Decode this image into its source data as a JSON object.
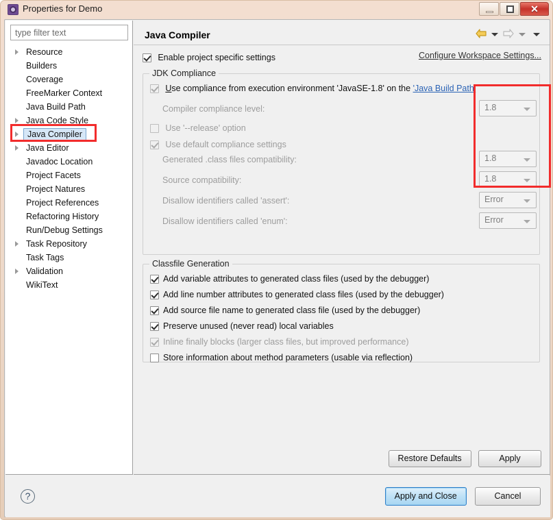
{
  "window": {
    "title": "Properties for Demo",
    "icon": "gear-icon",
    "minimize_label": "Minimize",
    "maximize_label": "Maximize",
    "close_label": "✕"
  },
  "sidebar": {
    "filter": {
      "placeholder": "type filter text",
      "value": ""
    },
    "items": [
      {
        "label": "Resource",
        "expandable": true,
        "selected": false
      },
      {
        "label": "Builders",
        "expandable": false,
        "selected": false
      },
      {
        "label": "Coverage",
        "expandable": false,
        "selected": false
      },
      {
        "label": "FreeMarker Context",
        "expandable": false,
        "selected": false
      },
      {
        "label": "Java Build Path",
        "expandable": false,
        "selected": false
      },
      {
        "label": "Java Code Style",
        "expandable": true,
        "selected": false
      },
      {
        "label": "Java Compiler",
        "expandable": true,
        "selected": true
      },
      {
        "label": "Java Editor",
        "expandable": true,
        "selected": false
      },
      {
        "label": "Javadoc Location",
        "expandable": false,
        "selected": false
      },
      {
        "label": "Project Facets",
        "expandable": false,
        "selected": false
      },
      {
        "label": "Project Natures",
        "expandable": false,
        "selected": false
      },
      {
        "label": "Project References",
        "expandable": false,
        "selected": false
      },
      {
        "label": "Refactoring History",
        "expandable": false,
        "selected": false
      },
      {
        "label": "Run/Debug Settings",
        "expandable": false,
        "selected": false
      },
      {
        "label": "Task Repository",
        "expandable": true,
        "selected": false
      },
      {
        "label": "Task Tags",
        "expandable": false,
        "selected": false
      },
      {
        "label": "Validation",
        "expandable": true,
        "selected": false
      },
      {
        "label": "WikiText",
        "expandable": false,
        "selected": false
      }
    ]
  },
  "page": {
    "title": "Java Compiler",
    "nav": {
      "back_icon": "back-arrow-icon",
      "back_menu_icon": "chevron-down-icon",
      "forward_icon": "forward-arrow-icon",
      "forward_menu_icon": "chevron-down-icon",
      "view_menu_icon": "chevron-down-icon"
    },
    "enable_project_specific": {
      "label": "Enable project specific settings",
      "checked": true
    },
    "configure_workspace_link": "Configure Workspace Settings...",
    "jdk_compliance": {
      "legend": "JDK Compliance",
      "use_execution_env": {
        "label_pre": "Use compliance from execution environment 'JavaSE-1.8' on the ",
        "label_link": "'Java Build Path'",
        "checked": true,
        "mnemonic": "U"
      },
      "compiler_compliance_level": {
        "label": "Compiler compliance level:",
        "value": "1.8",
        "enabled": false
      },
      "use_release_option": {
        "label": "Use '--release' option",
        "checked": false,
        "enabled": false
      },
      "use_default_compliance": {
        "label": "Use default compliance settings",
        "checked": true,
        "enabled": false
      },
      "generated_class_compat": {
        "label": "Generated .class files compatibility:",
        "value": "1.8",
        "enabled": false
      },
      "source_compat": {
        "label": "Source compatibility:",
        "value": "1.8",
        "enabled": false
      },
      "disallow_assert": {
        "label": "Disallow identifiers called 'assert':",
        "value": "Error",
        "enabled": false
      },
      "disallow_enum": {
        "label": "Disallow identifiers called 'enum':",
        "value": "Error",
        "enabled": false
      }
    },
    "classfile_generation": {
      "legend": "Classfile Generation",
      "options": [
        {
          "label": "Add variable attributes to generated class files (used by the debugger)",
          "checked": true,
          "enabled": true
        },
        {
          "label": "Add line number attributes to generated class files (used by the debugger)",
          "checked": true,
          "enabled": true
        },
        {
          "label": "Add source file name to generated class file (used by the debugger)",
          "checked": true,
          "enabled": true
        },
        {
          "label": "Preserve unused (never read) local variables",
          "checked": true,
          "enabled": true
        },
        {
          "label": "Inline finally blocks (larger class files, but improved performance)",
          "checked": true,
          "enabled": false
        },
        {
          "label": "Store information about method parameters (usable via reflection)",
          "checked": false,
          "enabled": true
        }
      ]
    },
    "restore_defaults_label": "Restore Defaults",
    "apply_label": "Apply"
  },
  "footer": {
    "help_icon": "help-question-icon",
    "apply_and_close_label": "Apply and Close",
    "cancel_label": "Cancel"
  },
  "annotations": {
    "accent_color": "#f22c2c",
    "sidebar_highlight": "Java Compiler",
    "combo_highlight": "compliance version dropdowns"
  }
}
